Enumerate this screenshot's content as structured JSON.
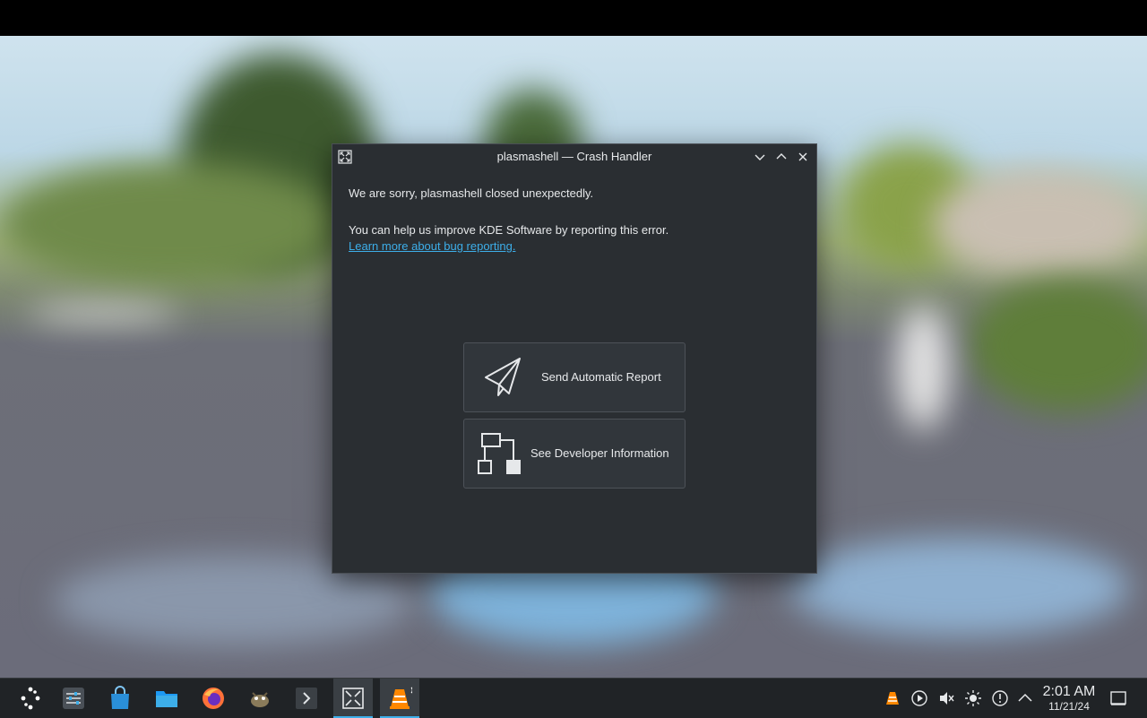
{
  "window": {
    "title": "plasmashell — Crash Handler",
    "message_sorry": "We are sorry, plasmashell closed unexpectedly.",
    "message_help": "You can help us improve KDE Software by reporting this error.",
    "learn_more_link": "Learn more about bug reporting.",
    "buttons": {
      "send_report": "Send Automatic Report",
      "developer_info": "See Developer Information"
    },
    "controls": [
      "minimize-icon",
      "maximize-icon",
      "close-icon"
    ]
  },
  "taskbar": {
    "items": [
      {
        "name": "application-launcher",
        "icon": "kde-launcher-icon"
      },
      {
        "name": "system-settings",
        "icon": "settings-sliders-icon"
      },
      {
        "name": "discover",
        "icon": "store-bag-icon"
      },
      {
        "name": "dolphin",
        "icon": "folder-icon"
      },
      {
        "name": "firefox",
        "icon": "firefox-icon"
      },
      {
        "name": "gimp",
        "icon": "gimp-icon"
      },
      {
        "name": "konsole",
        "icon": "terminal-icon"
      },
      {
        "name": "crash-handler",
        "icon": "crash-handler-icon"
      },
      {
        "name": "vlc",
        "icon": "vlc-cone-icon"
      }
    ],
    "tray": [
      "vlc-tray-icon",
      "media-player-icon",
      "volume-muted-icon",
      "brightness-icon",
      "network-icon",
      "expand-tray-icon"
    ],
    "clock": {
      "time": "2:01 AM",
      "date": "11/21/24"
    },
    "show_desktop": "show-desktop-icon"
  },
  "colors": {
    "accent": "#3daee9",
    "dialog_bg": "#2a2e32",
    "taskbar_bg": "#202326"
  }
}
